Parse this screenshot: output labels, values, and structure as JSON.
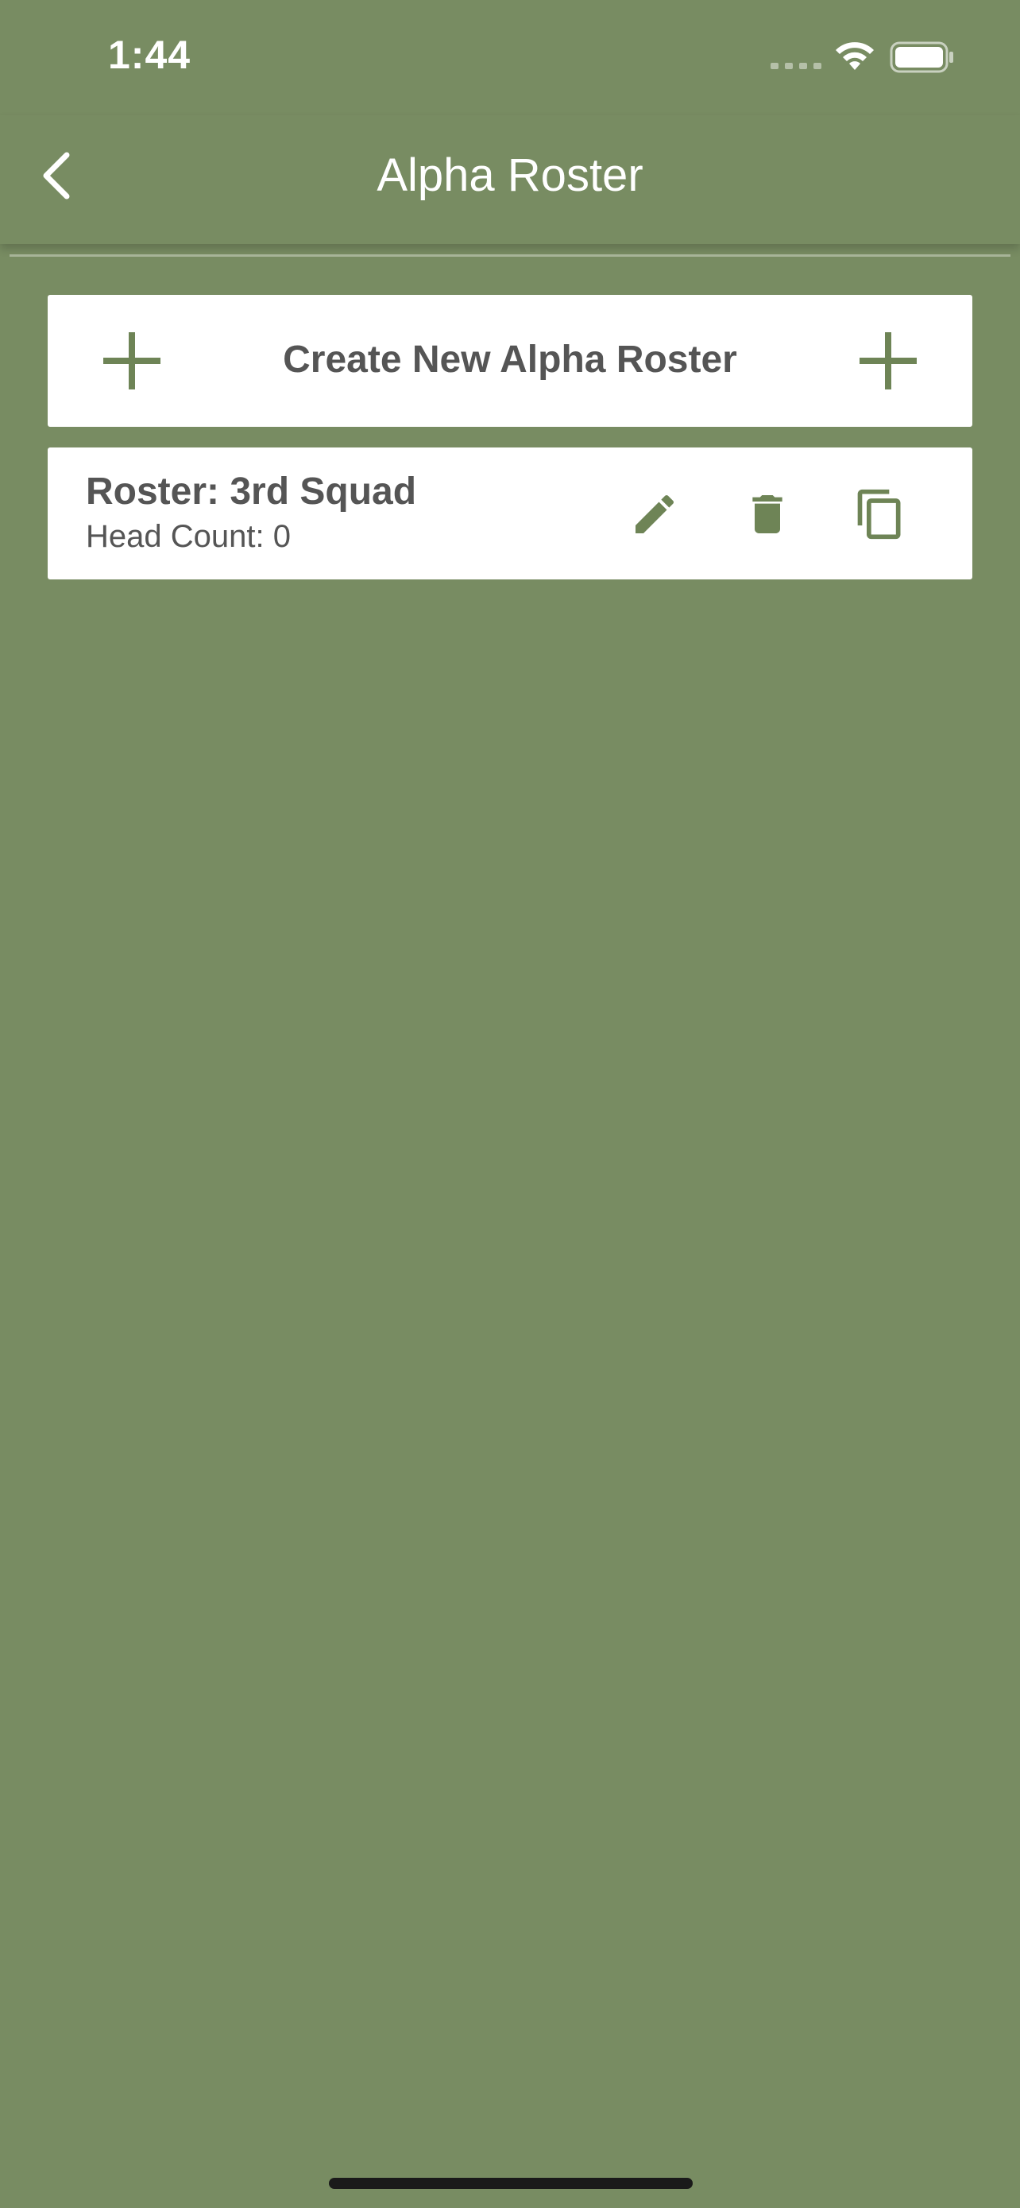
{
  "status_bar": {
    "time": "1:44"
  },
  "nav": {
    "title": "Alpha Roster",
    "back_icon": "chevron-left-icon"
  },
  "create_button": {
    "label": "Create New Alpha Roster",
    "icon": "plus-icon"
  },
  "rosters": [
    {
      "name": "Roster: 3rd Squad",
      "head_count": "Head Count: 0"
    }
  ],
  "colors": {
    "background": "#788c62",
    "card": "#ffffff",
    "accent_icon": "#6e8456",
    "text": "#555555"
  }
}
